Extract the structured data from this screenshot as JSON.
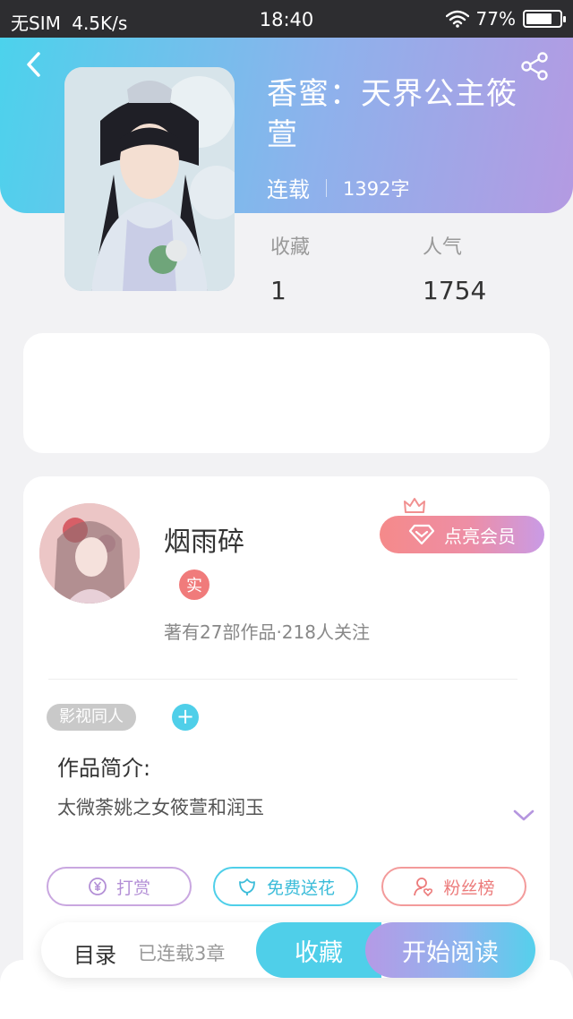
{
  "status_bar": {
    "carrier": "无SIM",
    "speed": "4.5K/s",
    "time": "18:40",
    "battery": "77%",
    "battery_level": 0.77
  },
  "book": {
    "title": "香蜜：天界公主筱萱",
    "status": "连载",
    "word_count": "1392字",
    "stats": [
      {
        "label": "收藏",
        "value": "1"
      },
      {
        "label": "人气",
        "value": "1754"
      }
    ]
  },
  "author": {
    "name": "烟雨碎",
    "verify_badge": "实",
    "vip_label": "点亮会员",
    "works_summary": "著有27部作品·218人关注"
  },
  "intro": {
    "tag": "影视同人",
    "add_tag": "+",
    "title": "作品简介:",
    "text": "太微荼姚之女筱萱和润玉"
  },
  "actions": [
    {
      "label": "打赏",
      "icon": "yen-coin-icon"
    },
    {
      "label": "免费送花",
      "icon": "flower-icon"
    },
    {
      "label": "粉丝榜",
      "icon": "fan-user-icon"
    }
  ],
  "bottom_bar": {
    "toc_label": "目录",
    "chapters": "已连载3章",
    "favorite_label": "收藏",
    "read_label": "开始阅读"
  },
  "colors": {
    "header_gradient_start": "#4cd2ec",
    "header_gradient_end": "#b49ae2",
    "accent_cyan": "#4fcfe9",
    "accent_purple": "#b59ae6",
    "accent_pink": "#f58a8a"
  }
}
